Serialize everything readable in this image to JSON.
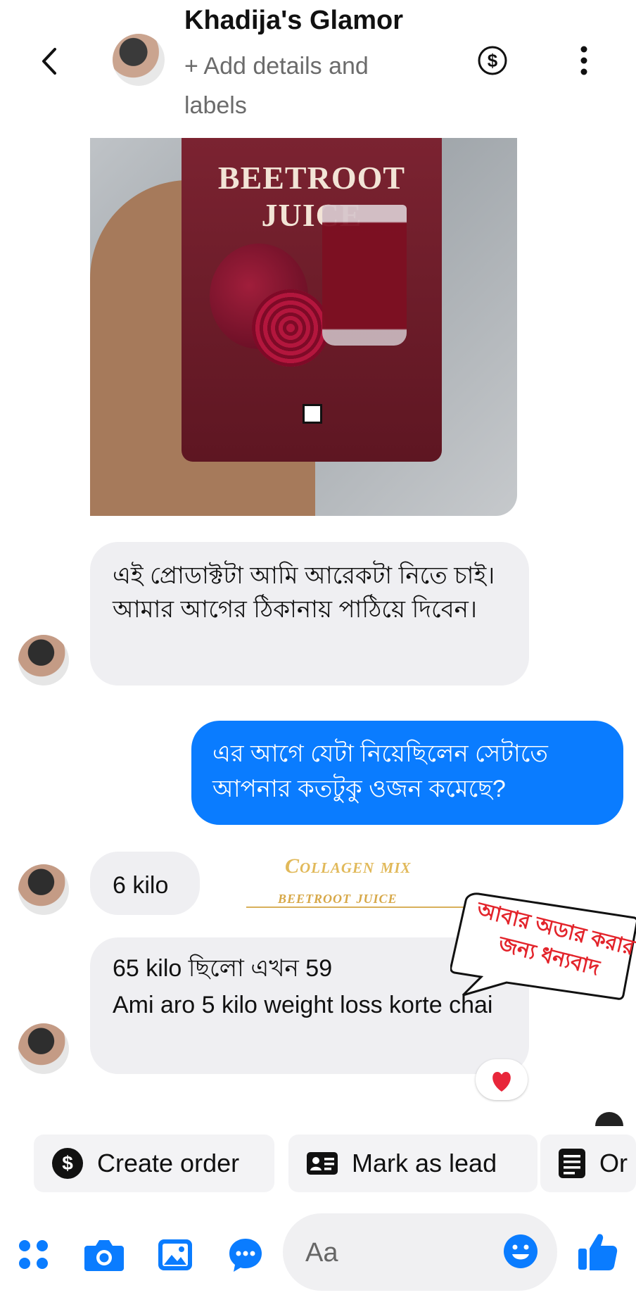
{
  "header": {
    "title": "Khadija's Glamor",
    "subtitle": "+ Add details and labels"
  },
  "product_photo": {
    "pack_text": "BEETROOT JUICE"
  },
  "messages": [
    {
      "sender": "them",
      "text": "এই প্রোডাক্টটা আমি আরেকটা নিতে চাই। আমার আগের ঠিকানায় পাঠিয়ে দিবেন।"
    },
    {
      "sender": "me",
      "text": "এর আগে যেটা নিয়েছিলেন সেটাতে আপনার কতটুকু ওজন কমেছে?"
    },
    {
      "sender": "them",
      "text": "6 kilo"
    },
    {
      "sender": "them",
      "text": "65 kilo ছিলো এখন 59\nAmi aro 5 kilo weight loss korte chai",
      "reaction": "heart"
    }
  ],
  "overlay": {
    "brand_line1": "Collagen mix",
    "brand_line2": "beetroot juice",
    "callout": "আবার অডার করার জন্য ধন্যবাদ",
    "callout_color": "#e3242b"
  },
  "quick_actions": [
    {
      "label": "Create order",
      "icon": "dollar-circle-icon"
    },
    {
      "label": "Mark as lead",
      "icon": "id-card-icon"
    },
    {
      "label": "Or",
      "icon": "document-icon"
    }
  ],
  "composer": {
    "placeholder": "Aa"
  },
  "colors": {
    "accent": "#0a7cff",
    "incoming_bubble": "#efeff2",
    "brand_gold": "#e1b95a"
  }
}
